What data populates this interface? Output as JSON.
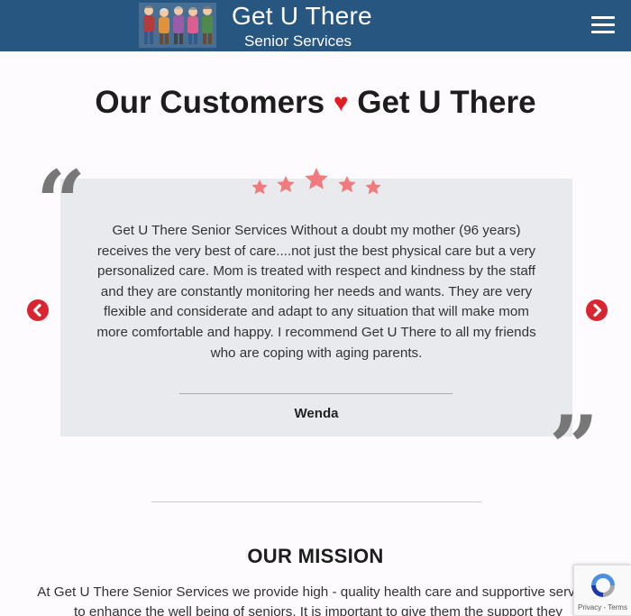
{
  "header": {
    "brand_title": "Get U There",
    "brand_subtitle": "Senior Services",
    "menu_icon": "hamburger-icon",
    "background_color": "#275680"
  },
  "testimonials": {
    "heading_part1": "Our Customers",
    "heading_heart": "♥",
    "heading_part2": "Get U There",
    "rating": 5,
    "rating_max": 5,
    "star_color": "#f07a7e",
    "quote": "Get U There Senior Services Without a doubt my mother (96 years) receives the very best of care....not just the best physical care but a very personalized care. Mom is treated with respect and kindness by the staff and they are constantly monitoring her needs and wants. They are very flexible and considerate and adapt to any situation that will make mom more comfortable and happy. I recommend Get U There to all my friends who are coping with aging parents.",
    "author": "Wenda",
    "open_quote_mark": "“",
    "close_quote_mark": "”",
    "prev_icon": "chevron-left-icon",
    "next_icon": "chevron-right-icon",
    "arrow_color": "#d9252f"
  },
  "mission": {
    "title": "OUR MISSION",
    "text": "At Get U There Senior Services we provide high - quality health care and supportive services to enhance the well being of seniors. It is important to give them the support they"
  },
  "recaptcha": {
    "links": "Privacy - Terms"
  }
}
